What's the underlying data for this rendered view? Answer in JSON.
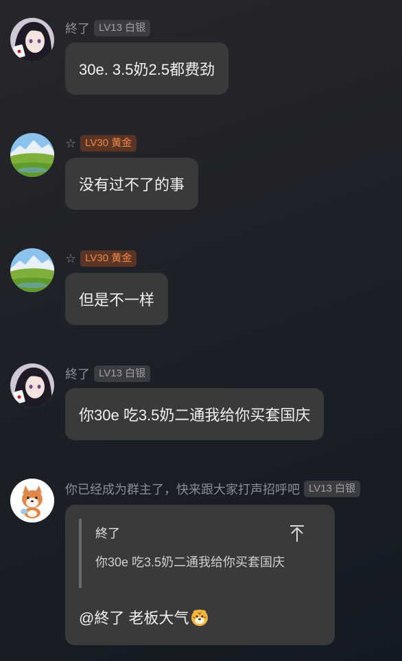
{
  "messages": [
    {
      "user": "終了",
      "level": "LV13 白银",
      "text": "30e. 3.5奶2.5都费劲"
    },
    {
      "user": "☆",
      "level": "LV30 黄金",
      "text": "没有过不了的事"
    },
    {
      "user": "☆",
      "level": "LV30 黄金",
      "text": "但是不一样"
    },
    {
      "user": "終了",
      "level": "LV13 白银",
      "text": "你30e 吃3.5奶二通我给你买套国庆"
    },
    {
      "user": "你已经成为群主了，快来跟大家打声招呼吧",
      "level": "LV13 白银",
      "quote": {
        "author": "終了",
        "text": "你30e 吃3.5奶二通我给你买套国庆"
      },
      "reply": "@終了 老板大气"
    }
  ],
  "icons": {
    "jump_to_quote": "arrow-up-to-line-icon",
    "reply_emoji": "tiger-face-emoji-icon"
  },
  "colors": {
    "silver_badge_text": "#9fa0a5",
    "gold_badge_text": "#f0874a",
    "bubble_bg": "#3a3a3a"
  }
}
